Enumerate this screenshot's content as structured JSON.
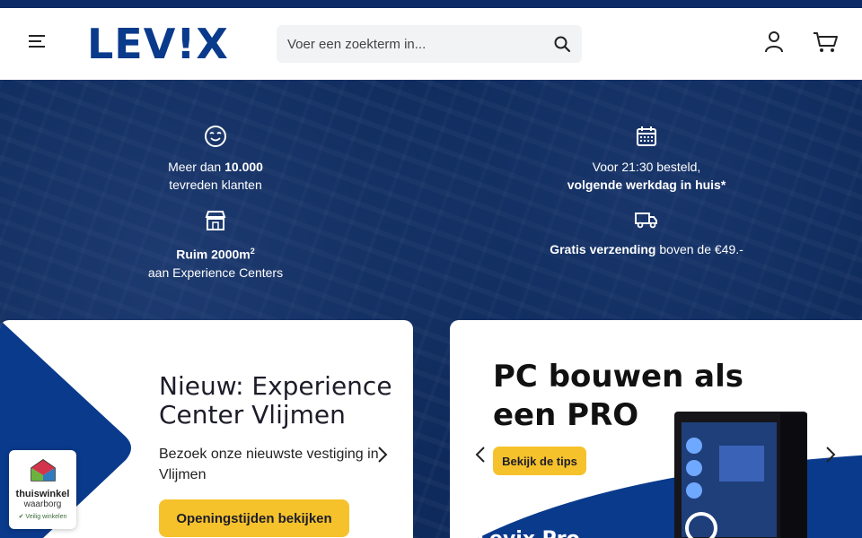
{
  "header": {
    "logo_text": "LEV!X",
    "search": {
      "placeholder": "Voer een zoekterm in..."
    }
  },
  "usps": {
    "customers": {
      "pre": "Meer dan ",
      "bold": "10.000",
      "line2": "tevreden klanten",
      "icon": "smiley-icon"
    },
    "delivery": {
      "line1": "Voor 21:30 besteld,",
      "bold": "volgende werkdag in huis*",
      "icon": "calendar-icon"
    },
    "experience": {
      "bold": "Ruim 2000m",
      "sup": "2",
      "line2": "aan Experience Centers",
      "icon": "store-icon"
    },
    "shipping": {
      "bold": "Gratis verzending",
      "post": " boven de €49.-",
      "icon": "truck-icon"
    }
  },
  "card1": {
    "title_line1": "Nieuw: Experience",
    "title_line2": "Center Vlijmen",
    "text": "Bezoek onze nieuwste vestiging in Vlijmen",
    "button": "Openingstijden bekijken"
  },
  "card2": {
    "title_line1": "PC bouwen als",
    "title_line2": "een PRO",
    "button": "Bekijk de tips",
    "partial_text": "Levix Pro"
  },
  "badge": {
    "line1": "thuiswinkel",
    "line2": "waarborg",
    "line3": "✔ Veilig winkelen"
  },
  "colors": {
    "navy": "#0e2a5c",
    "brand": "#0a3a8c",
    "accent": "#f6c22b"
  }
}
